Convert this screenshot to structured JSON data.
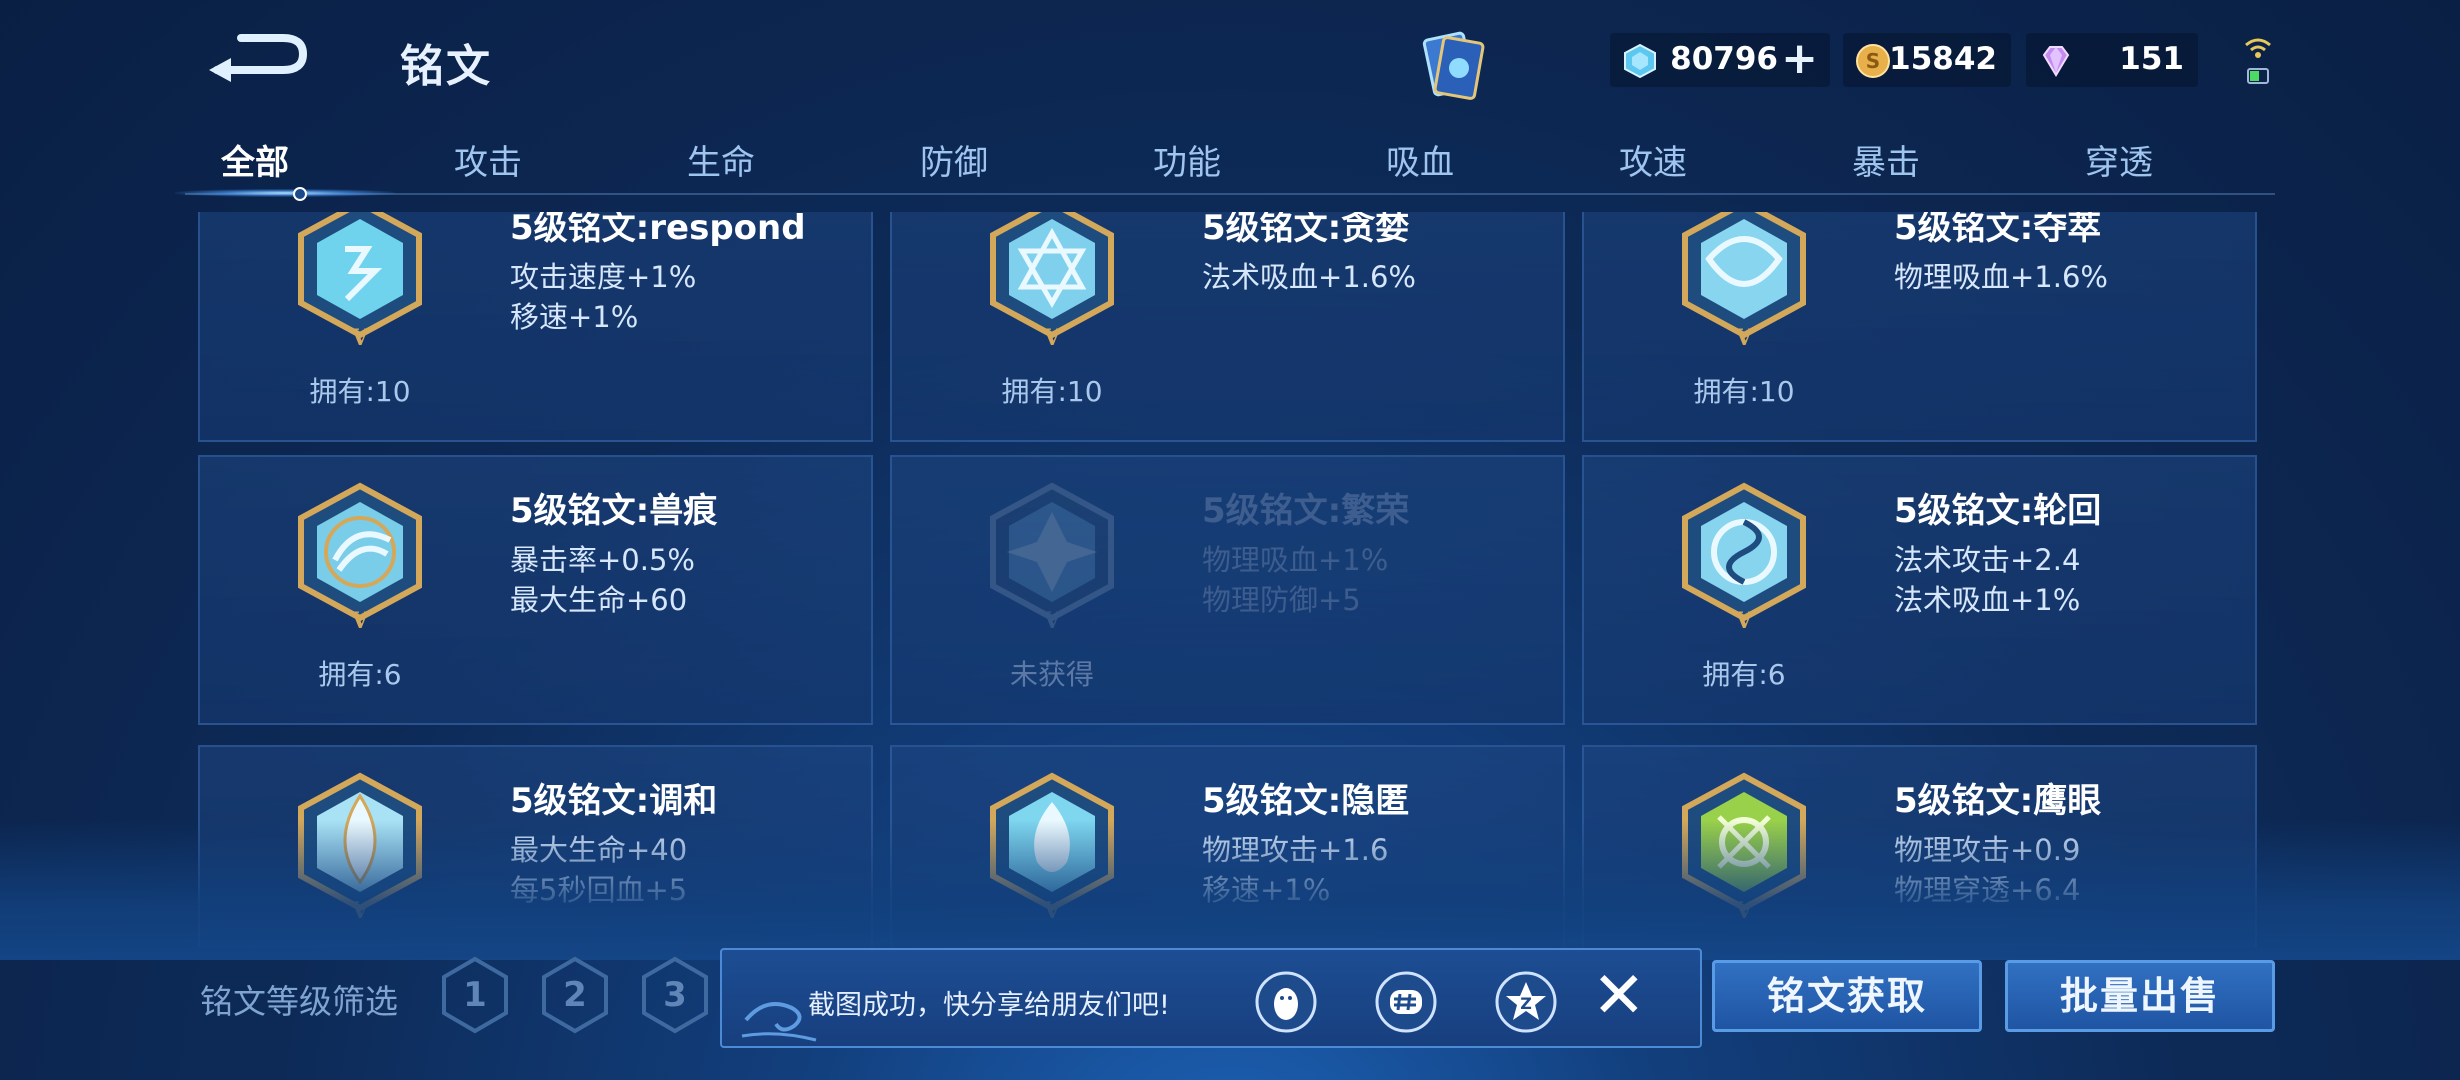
{
  "header": {
    "title": "铭文",
    "currencies": [
      {
        "icon": "diamond-gem-icon",
        "value": "80796",
        "has_plus": true
      },
      {
        "icon": "gold-coin-icon",
        "value": "15842"
      },
      {
        "icon": "purple-crystal-icon",
        "value": "151"
      }
    ]
  },
  "tabs": [
    "全部",
    "攻击",
    "生命",
    "防御",
    "功能",
    "吸血",
    "攻速",
    "暴击",
    "穿透"
  ],
  "active_tab": "全部",
  "cards": [
    {
      "name": "5级铭文:respond",
      "stat1": "攻击速度+1%",
      "stat2": "移速+1%",
      "own": "拥有:10",
      "owned": true,
      "color": "#6fd3ee"
    },
    {
      "name": "5级铭文:贪婪",
      "stat1": "法术吸血+1.6%",
      "stat2": "",
      "own": "拥有:10",
      "owned": true,
      "color": "#7fd0ec"
    },
    {
      "name": "5级铭文:夺萃",
      "stat1": "物理吸血+1.6%",
      "stat2": "",
      "own": "拥有:10",
      "owned": true,
      "color": "#88d5f0"
    },
    {
      "name": "5级铭文:兽痕",
      "stat1": "暴击率+0.5%",
      "stat2": "最大生命+60",
      "own": "拥有:6",
      "owned": true,
      "color": "#7acde8"
    },
    {
      "name": "5级铭文:繁荣",
      "stat1": "物理吸血+1%",
      "stat2": "物理防御+5",
      "own": "未获得",
      "owned": false,
      "color": "#6fa8d0"
    },
    {
      "name": "5级铭文:轮回",
      "stat1": "法术攻击+2.4",
      "stat2": "法术吸血+1%",
      "own": "拥有:6",
      "owned": true,
      "color": "#86d4ee"
    },
    {
      "name": "5级铭文:调和",
      "stat1": "最大生命+40",
      "stat2": "每5秒回血+5",
      "own": "",
      "owned": true,
      "color": "#a9e2f5"
    },
    {
      "name": "5级铭文:隐匿",
      "stat1": "物理攻击+1.6",
      "stat2": "移速+1%",
      "own": "",
      "owned": true,
      "color": "#7ed6ef"
    },
    {
      "name": "5级铭文:鹰眼",
      "stat1": "物理攻击+0.9",
      "stat2": "物理穿透+6.4",
      "own": "",
      "owned": true,
      "color": "#9ad14a"
    }
  ],
  "filter": {
    "label": "铭文等级筛选",
    "levels": [
      "1",
      "2",
      "3"
    ]
  },
  "toast": {
    "message": "截图成功，快分享给朋友们吧!"
  },
  "buttons": {
    "acquire": "铭文获取",
    "bulk_sell": "批量出售"
  }
}
